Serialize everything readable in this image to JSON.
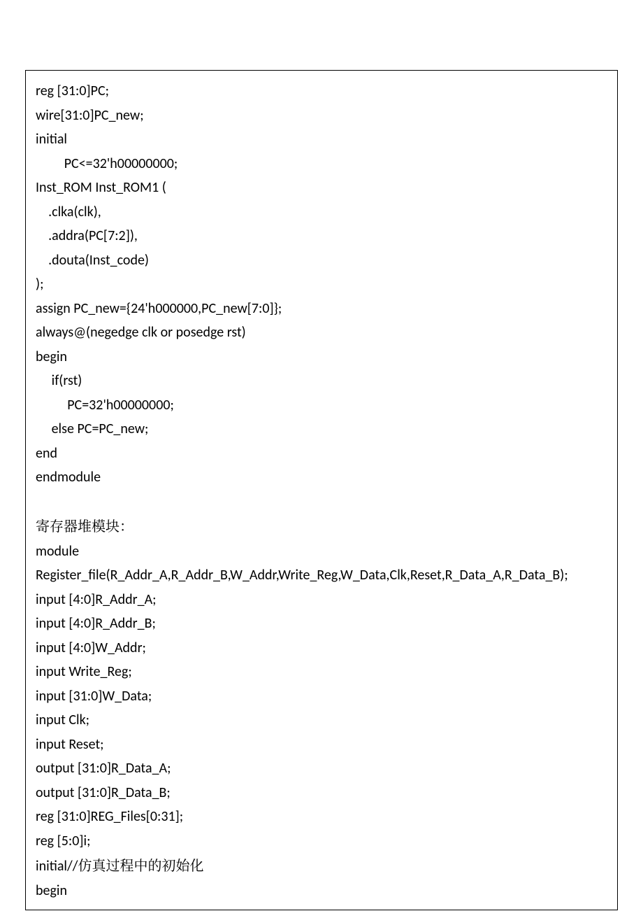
{
  "code": {
    "lines": [
      "reg [31:0]PC;",
      "wire[31:0]PC_new;",
      "initial",
      "         PC<=32'h00000000;",
      "Inst_ROM Inst_ROM1 (",
      "    .clka(clk),",
      "    .addra(PC[7:2]),",
      "    .douta(Inst_code)",
      ");",
      "assign PC_new={24'h000000,PC_new[7:0]};",
      "always@(negedge clk or posedge rst)",
      "begin",
      "     if(rst)",
      "          PC=32'h00000000;",
      "     else PC=PC_new;",
      "end",
      "endmodule",
      "",
      "__CN_REGFILE__",
      "module",
      "Register_file(R_Addr_A,R_Addr_B,W_Addr,Write_Reg,W_Data,Clk,Reset,R_Data_A,R_Data_B);",
      "input [4:0]R_Addr_A;",
      "input [4:0]R_Addr_B;",
      "input [4:0]W_Addr;",
      "input Write_Reg;",
      "input [31:0]W_Data;",
      "input Clk;",
      "input Reset;",
      "output [31:0]R_Data_A;",
      "output [31:0]R_Data_B;",
      "reg [31:0]REG_Files[0:31];",
      "reg [5:0]i;",
      "__CN_INITIAL__",
      "begin"
    ],
    "cn_regfile": "寄存器堆模块：",
    "cn_initial_prefix": "initial//",
    "cn_initial_comment": "仿真过程中的初始化"
  }
}
